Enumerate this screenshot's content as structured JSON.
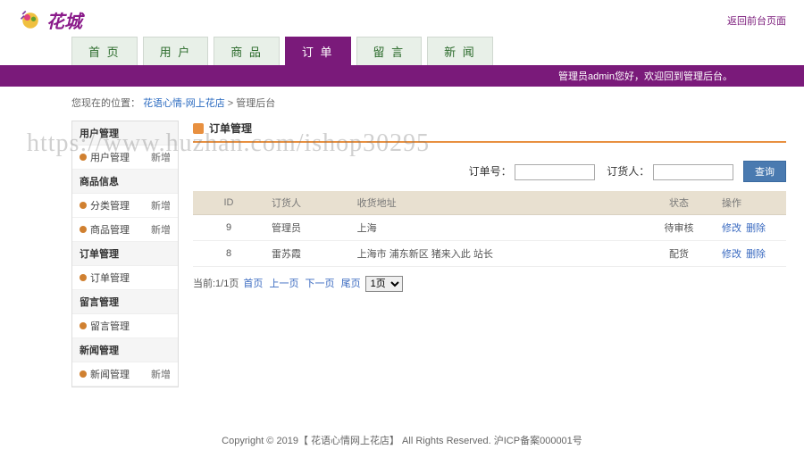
{
  "header": {
    "logo_text": "花城",
    "front_link": "返回前台页面"
  },
  "nav": {
    "items": [
      "首 页",
      "用 户",
      "商 品",
      "订 单",
      "留 言",
      "新 闻"
    ],
    "active_index": 3
  },
  "purple_bar": "管理员admin您好，欢迎回到管理后台。",
  "breadcrumb": {
    "prefix": "您现在的位置：",
    "link": "花语心情-网上花店",
    "current": "管理后台"
  },
  "sidebar": {
    "sections": [
      {
        "title": "用户管理",
        "items": [
          {
            "label": "用户管理",
            "add": "新增"
          }
        ]
      },
      {
        "title": "商品信息",
        "items": [
          {
            "label": "分类管理",
            "add": "新增"
          },
          {
            "label": "商品管理",
            "add": "新增"
          }
        ]
      },
      {
        "title": "订单管理",
        "items": [
          {
            "label": "订单管理",
            "add": ""
          }
        ]
      },
      {
        "title": "留言管理",
        "items": [
          {
            "label": "留言管理",
            "add": ""
          }
        ]
      },
      {
        "title": "新闻管理",
        "items": [
          {
            "label": "新闻管理",
            "add": "新增"
          }
        ]
      }
    ]
  },
  "content": {
    "title": "订单管理",
    "search": {
      "order_label": "订单号：",
      "person_label": "订货人：",
      "btn": "查询"
    },
    "table": {
      "headers": [
        "ID",
        "订货人",
        "收货地址",
        "状态",
        "操作"
      ],
      "rows": [
        {
          "id": "9",
          "person": "管理员",
          "address": "上海",
          "status": "待审核",
          "edit": "修改",
          "del": "删除"
        },
        {
          "id": "8",
          "person": "雷苏霞",
          "address": "上海市 浦东新区 猪来入此 站长",
          "status": "配货",
          "edit": "修改",
          "del": "删除"
        }
      ]
    },
    "pager": {
      "info": "当前:1/1页",
      "first": "首页",
      "prev": "上一页",
      "next": "下一页",
      "last": "尾页",
      "select": "1页"
    }
  },
  "footer": "Copyright © 2019【 花语心情网上花店】 All Rights Reserved.  沪ICP备案000001号",
  "watermark": "https://www.huzhan.com/ishop30295"
}
